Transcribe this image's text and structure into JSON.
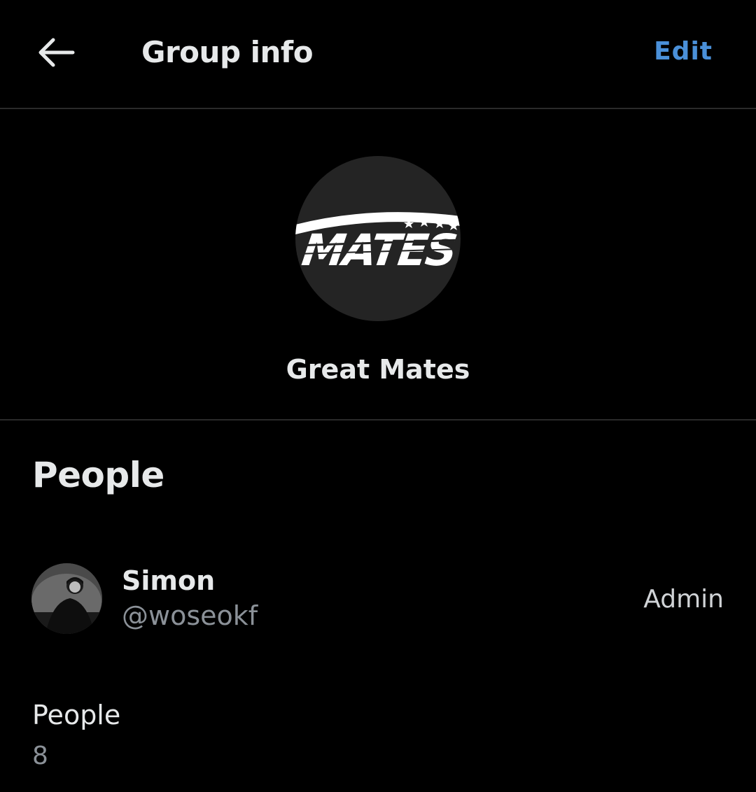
{
  "header": {
    "back_icon": "arrow-left-icon",
    "title": "Group info",
    "edit_label": "Edit",
    "accent_color": "#4a90d9"
  },
  "group": {
    "logo_text": "MATES",
    "name": "Great Mates"
  },
  "people_section": {
    "title": "People",
    "members": [
      {
        "name": "Simon",
        "handle": "@woseokf",
        "role": "Admin"
      }
    ],
    "count_label": "People",
    "count_value": "8"
  }
}
